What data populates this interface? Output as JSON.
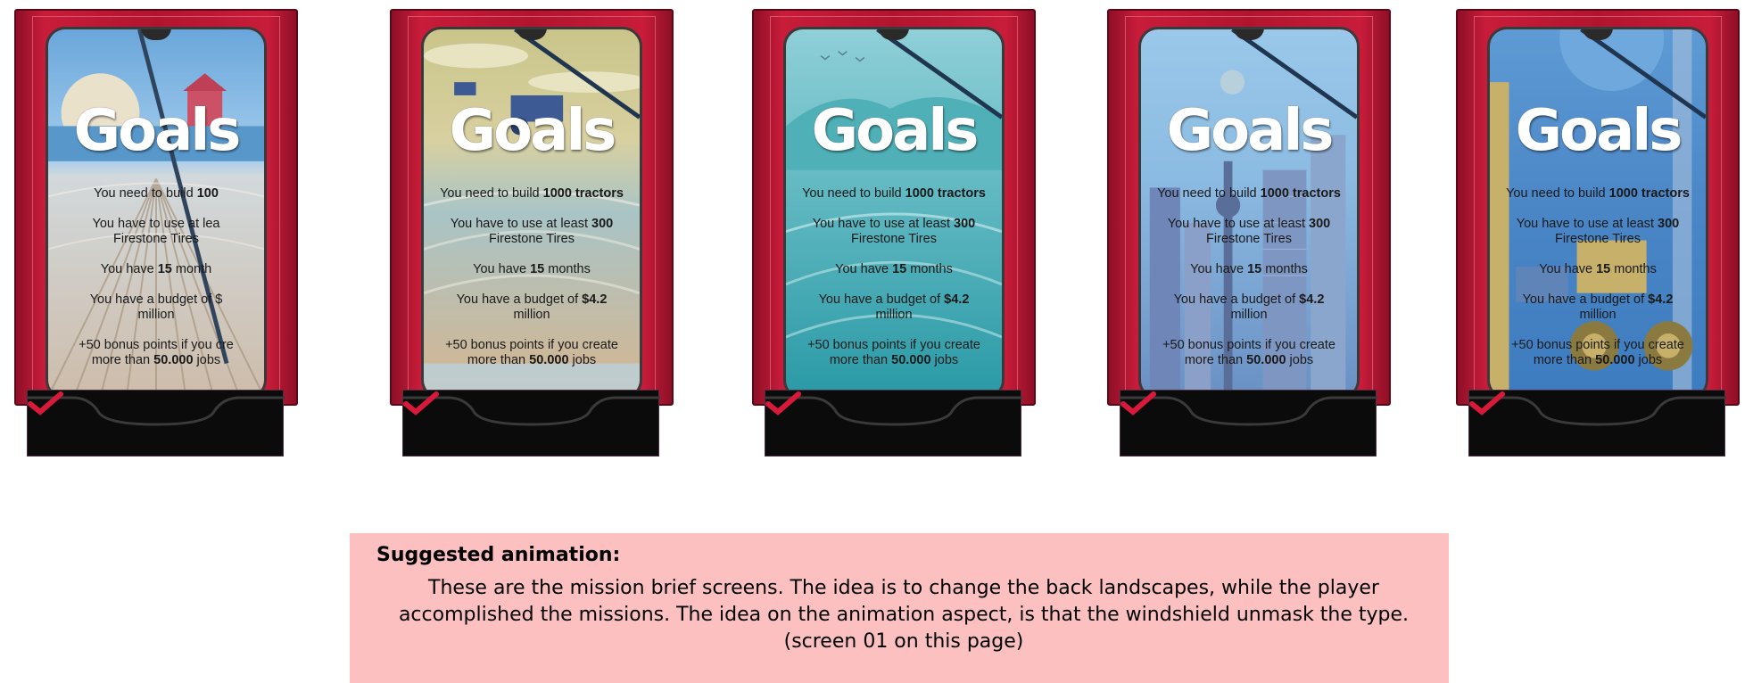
{
  "cards": [
    {
      "goals_title": "Goals",
      "line1": "You need to build ",
      "line1_bold": "100",
      "line2": "You have to use at lea",
      "line2b": "Firestone Tires",
      "line3": "You have ",
      "line3_bold": "15",
      "line3_end": " month",
      "line4": "You have a budget of $",
      "line4b": "million",
      "line5": "+50 bonus points if you cre",
      "line5b": "more than ",
      "line5_bold": "50.000",
      "line5_end": " jobs",
      "landscape": "farm-field-with-barn"
    },
    {
      "goals_title": "Goals",
      "line1": "You need to build ",
      "line1_bold": "1000 tractors",
      "line2": "You have to use at least ",
      "line2_bold": "300",
      "line2b": "Firestone Tires",
      "line3": "You have ",
      "line3_bold": "15",
      "line3_end": " months",
      "line4": "You have a budget of ",
      "line4_bold": "$4.2",
      "line4b": "million",
      "line5": "+50 bonus points if you create",
      "line5b": "more than ",
      "line5_bold": "50.000",
      "line5_end": " jobs",
      "landscape": "fields-with-tractors"
    },
    {
      "goals_title": "Goals",
      "line1": "You need to build ",
      "line1_bold": "1000 tractors",
      "line2": "You have to use at least ",
      "line2_bold": "300",
      "line2b": "Firestone Tires",
      "line3": "You have ",
      "line3_bold": "15",
      "line3_end": " months",
      "line4": "You have a budget of ",
      "line4_bold": "$4.2",
      "line4b": "million",
      "line5": "+50 bonus points if you create",
      "line5b": "more than ",
      "line5_bold": "50.000",
      "line5_end": " jobs",
      "landscape": "teal-hills-with-birds"
    },
    {
      "goals_title": "Goals",
      "line1": "You need to build ",
      "line1_bold": "1000 tractors",
      "line2": "You have to use at least ",
      "line2_bold": "300",
      "line2b": "Firestone Tires",
      "line3": "You have ",
      "line3_bold": "15",
      "line3_end": " months",
      "line4": "You have a budget of ",
      "line4_bold": "$4.2",
      "line4b": "million",
      "line5": "+50 bonus points if you create",
      "line5b": "more than ",
      "line5_bold": "50.000",
      "line5_end": " jobs",
      "landscape": "city-skyline"
    },
    {
      "goals_title": "Goals",
      "line1": "You need to build ",
      "line1_bold": "1000 tractors",
      "line2": "You have to use at least ",
      "line2_bold": "300",
      "line2b": "Firestone Tires",
      "line3": "You have ",
      "line3_bold": "15",
      "line3_end": " months",
      "line4": "You have a budget of ",
      "line4_bold": "$4.2",
      "line4b": "million",
      "line5": "+50 bonus points if you create",
      "line5b": "more than ",
      "line5_bold": "50.000",
      "line5_end": " jobs",
      "landscape": "factory-with-tractor"
    }
  ],
  "note": {
    "heading": "Suggested animation:",
    "text": "These are the mission brief screens. The idea is to change the back landscapes, while the player accomplished the missions. The idea on the animation aspect, is that the windshield unmask the type. (screen 01 on this page)"
  },
  "colors": {
    "frame_red": "#b0152f",
    "tray_black": "#0b0b0b",
    "check_red": "#d81a3a",
    "note_pink": "#fdc0c0"
  }
}
